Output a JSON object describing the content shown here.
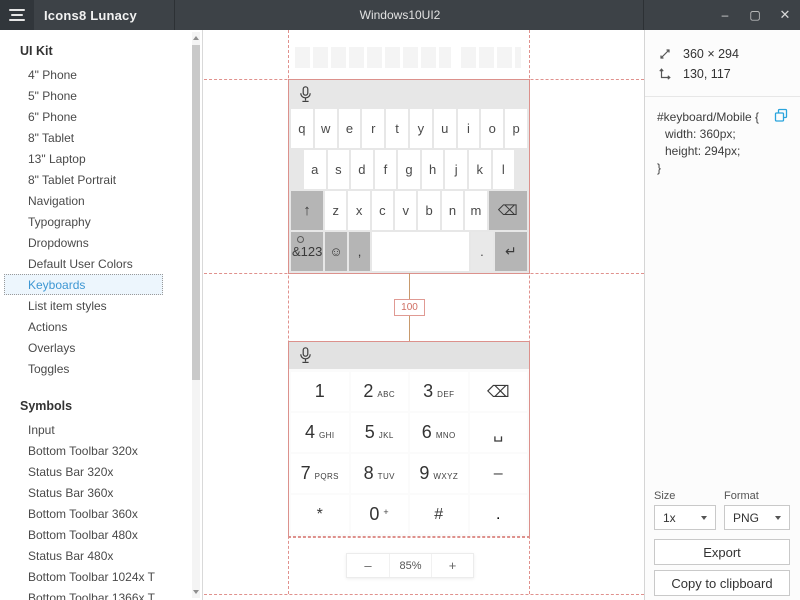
{
  "titlebar": {
    "app_name": "Icons8 Lunacy",
    "document_title": "Windows10UI2",
    "minimize": "–",
    "maximize": "▢",
    "close": "✕"
  },
  "sidebar": {
    "selected_item": "Keyboards",
    "sections": [
      {
        "header": "UI Kit",
        "items": [
          "4\" Phone",
          "5\" Phone",
          "6\" Phone",
          "8\" Tablet",
          "13\" Laptop",
          "8\" Tablet Portrait",
          "Navigation",
          "Typography",
          "Dropdowns",
          "Default User Colors",
          {
            "label": "Keyboards",
            "cls": "selected"
          },
          "List item styles",
          "Actions",
          "Overlays",
          "Toggles"
        ]
      },
      {
        "header": "Symbols",
        "items": [
          "Input",
          "Bottom Toolbar 320x",
          "Status Bar 320x",
          "Status Bar 360x",
          "Bottom Toolbar 360x",
          "Bottom Toolbar 480x",
          "Status Bar 480x",
          "Bottom Toolbar 1024x T",
          "Bottom Toolbar 1366x T"
        ]
      }
    ]
  },
  "canvas": {
    "measurement": "100",
    "zoom": {
      "minus": "–",
      "level": "85%",
      "plus": "+"
    },
    "qwerty": {
      "row1": [
        "q",
        "w",
        "e",
        "r",
        "t",
        "y",
        "u",
        "i",
        "o",
        "p"
      ],
      "row2": [
        "a",
        "s",
        "d",
        "f",
        "g",
        "h",
        "j",
        "k",
        "l"
      ],
      "row3": [
        {
          "label": "↑",
          "cls": "k-gray k-f15 k-arrow"
        },
        "z",
        "x",
        "c",
        "v",
        "b",
        "n",
        "m",
        {
          "label": "⌫",
          "cls": "k-gray k-f18 k-bs"
        }
      ],
      "row4": [
        {
          "label": "&123",
          "cls": "k-gray k-f15 k-gear"
        },
        {
          "label": "☺",
          "cls": "k-gray"
        },
        {
          "label": ",",
          "cls": "k-gray"
        },
        {
          "label": "",
          "cls": "k-f45"
        },
        {
          "label": ".",
          "cls": "k-light"
        },
        {
          "label": "↵",
          "cls": "k-gray k-f15 k-enter"
        }
      ]
    },
    "numpad": {
      "row1": [
        {
          "label": "1",
          "sub": ""
        },
        {
          "label": "2",
          "sub": "ABC"
        },
        {
          "label": "3",
          "sub": "DEF"
        },
        {
          "label": "⌫",
          "cls": "k-gray"
        }
      ],
      "row2": [
        {
          "label": "4",
          "sub": "GHI"
        },
        {
          "label": "5",
          "sub": "JKL"
        },
        {
          "label": "6",
          "sub": "MNO"
        },
        {
          "label": "␣",
          "cls": "k-gray"
        }
      ],
      "row3": [
        {
          "label": "7",
          "sub": "PQRS"
        },
        {
          "label": "8",
          "sub": "TUV"
        },
        {
          "label": "9",
          "sub": "WXYZ"
        },
        {
          "label": "–",
          "cls": "k-gray"
        }
      ],
      "row4": [
        {
          "label": "*",
          "cls": "k-gray k-star"
        },
        {
          "label": "0",
          "sub": "+",
          "cls": "k-plus"
        },
        {
          "label": "#",
          "cls": "k-gray"
        },
        {
          "label": ".",
          "cls": "k-light"
        }
      ]
    }
  },
  "inspector": {
    "size_value": "360 × 294",
    "position_value": "130, 117",
    "css_lines": [
      "#keyboard/Mobile {",
      "width: 360px;",
      "height: 294px;",
      "}"
    ],
    "export": {
      "size_label": "Size",
      "size_value": "1x",
      "format_label": "Format",
      "format_value": "PNG",
      "export_label": "Export",
      "copy_label": "Copy to clipboard"
    }
  },
  "colors": {
    "titlebar": "#3d4247",
    "accent_blue": "#2fa0dc",
    "selection_red": "#e0918d",
    "measure_orange": "#c89a6c",
    "key_gray": "#b5b5b5"
  }
}
